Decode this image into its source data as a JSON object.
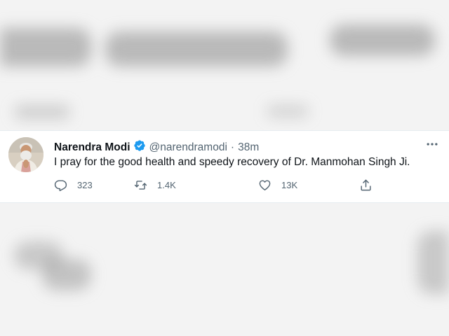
{
  "tweet": {
    "display_name": "Narendra Modi",
    "verified": true,
    "handle": "@narendramodi",
    "separator": "·",
    "time": "38m",
    "text": "I pray for the good health and speedy recovery of Dr. Manmohan Singh Ji.",
    "actions": {
      "reply_count": "323",
      "retweet_count": "1.4K",
      "like_count": "13K"
    }
  },
  "icons": {
    "more": "more-horizontal-icon",
    "verified": "verified-badge-icon",
    "reply": "reply-icon",
    "retweet": "retweet-icon",
    "like": "heart-icon",
    "share": "share-icon"
  },
  "colors": {
    "verified_blue": "#1d9bf0",
    "text_primary": "#0f1419",
    "text_secondary": "#536471"
  }
}
